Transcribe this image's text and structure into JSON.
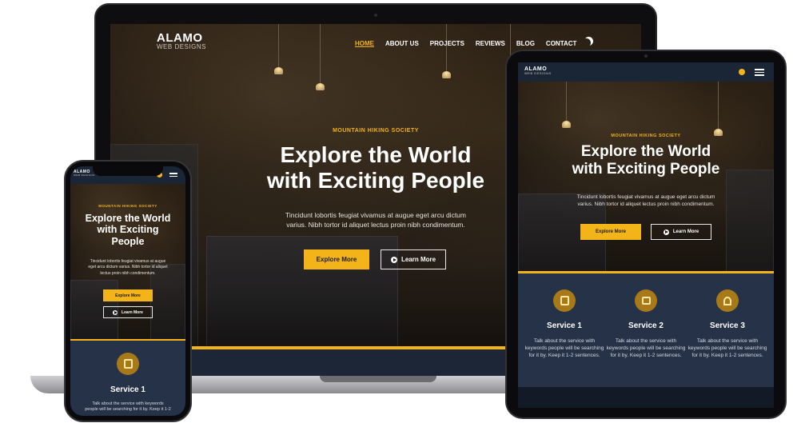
{
  "laptop": {
    "logo": {
      "main": "ALAMO",
      "sub": "WEB DESIGNS"
    },
    "nav": [
      "HOME",
      "ABOUT US",
      "PROJECTS",
      "REVIEWS",
      "BLOG",
      "CONTACT"
    ],
    "nav_active": "HOME",
    "eyebrow": "MOUNTAIN HIKING SOCIETY",
    "title_line1": "Explore the World",
    "title_line2": "with Exciting People",
    "subtitle_line1": "Tincidunt lobortis feugiat vivamus at augue eget arcu dictum",
    "subtitle_line2": "varius. Nibh tortor id aliquet lectus proin nibh condimentum.",
    "primary_button": "Explore More",
    "secondary_button": "Learn More"
  },
  "tablet": {
    "logo": {
      "main": "ALAMO",
      "sub": "WEB DESIGNS"
    },
    "eyebrow": "MOUNTAIN HIKING SOCIETY",
    "title_line1": "Explore the World",
    "title_line2": "with Exciting People",
    "subtitle_line1": "Tincidunt lobortis feugiat vivamus at augue eget arcu dictum",
    "subtitle_line2": "varius. Nibh tortor id aliquet lectus proin nibh condimentum.",
    "primary_button": "Explore More",
    "secondary_button": "Learn More",
    "services": [
      {
        "title": "Service 1",
        "text": "Talk about the service with keywords people will be searching for it by. Keep it 1-2 sentences.",
        "icon": "building-icon"
      },
      {
        "title": "Service 2",
        "text": "Talk about the service with keywords people will be searching for it by. Keep it 1-2 sentences.",
        "icon": "house-icon"
      },
      {
        "title": "Service 3",
        "text": "Talk about the service with keywords people will be searching for it by. Keep it 1-2 sentences.",
        "icon": "traffic-cone-icon"
      }
    ]
  },
  "phone": {
    "logo": {
      "main": "ALAMO",
      "sub": "WEB DESIGNS"
    },
    "eyebrow": "MOUNTAIN HIKING SOCIETY",
    "title_line1": "Explore the World",
    "title_line2": "with Exciting",
    "title_line3": "People",
    "subtitle_line1": "Tincidunt lobortis feugiat vivamus at augue",
    "subtitle_line2": "eget arcu dictum varius. Nibh tortor id aliquet",
    "subtitle_line3": "lectus proin nibh condimentum.",
    "primary_button": "Explore More",
    "secondary_button": "Learn More",
    "service_title": "Service 1",
    "service_text_line1": "Talk about the service with keywords",
    "service_text_line2": "people will be searching for it by. Keep it 1-2"
  },
  "colors": {
    "accent": "#f2b418",
    "navy": "#253247",
    "icon_bg": "#a77918"
  }
}
